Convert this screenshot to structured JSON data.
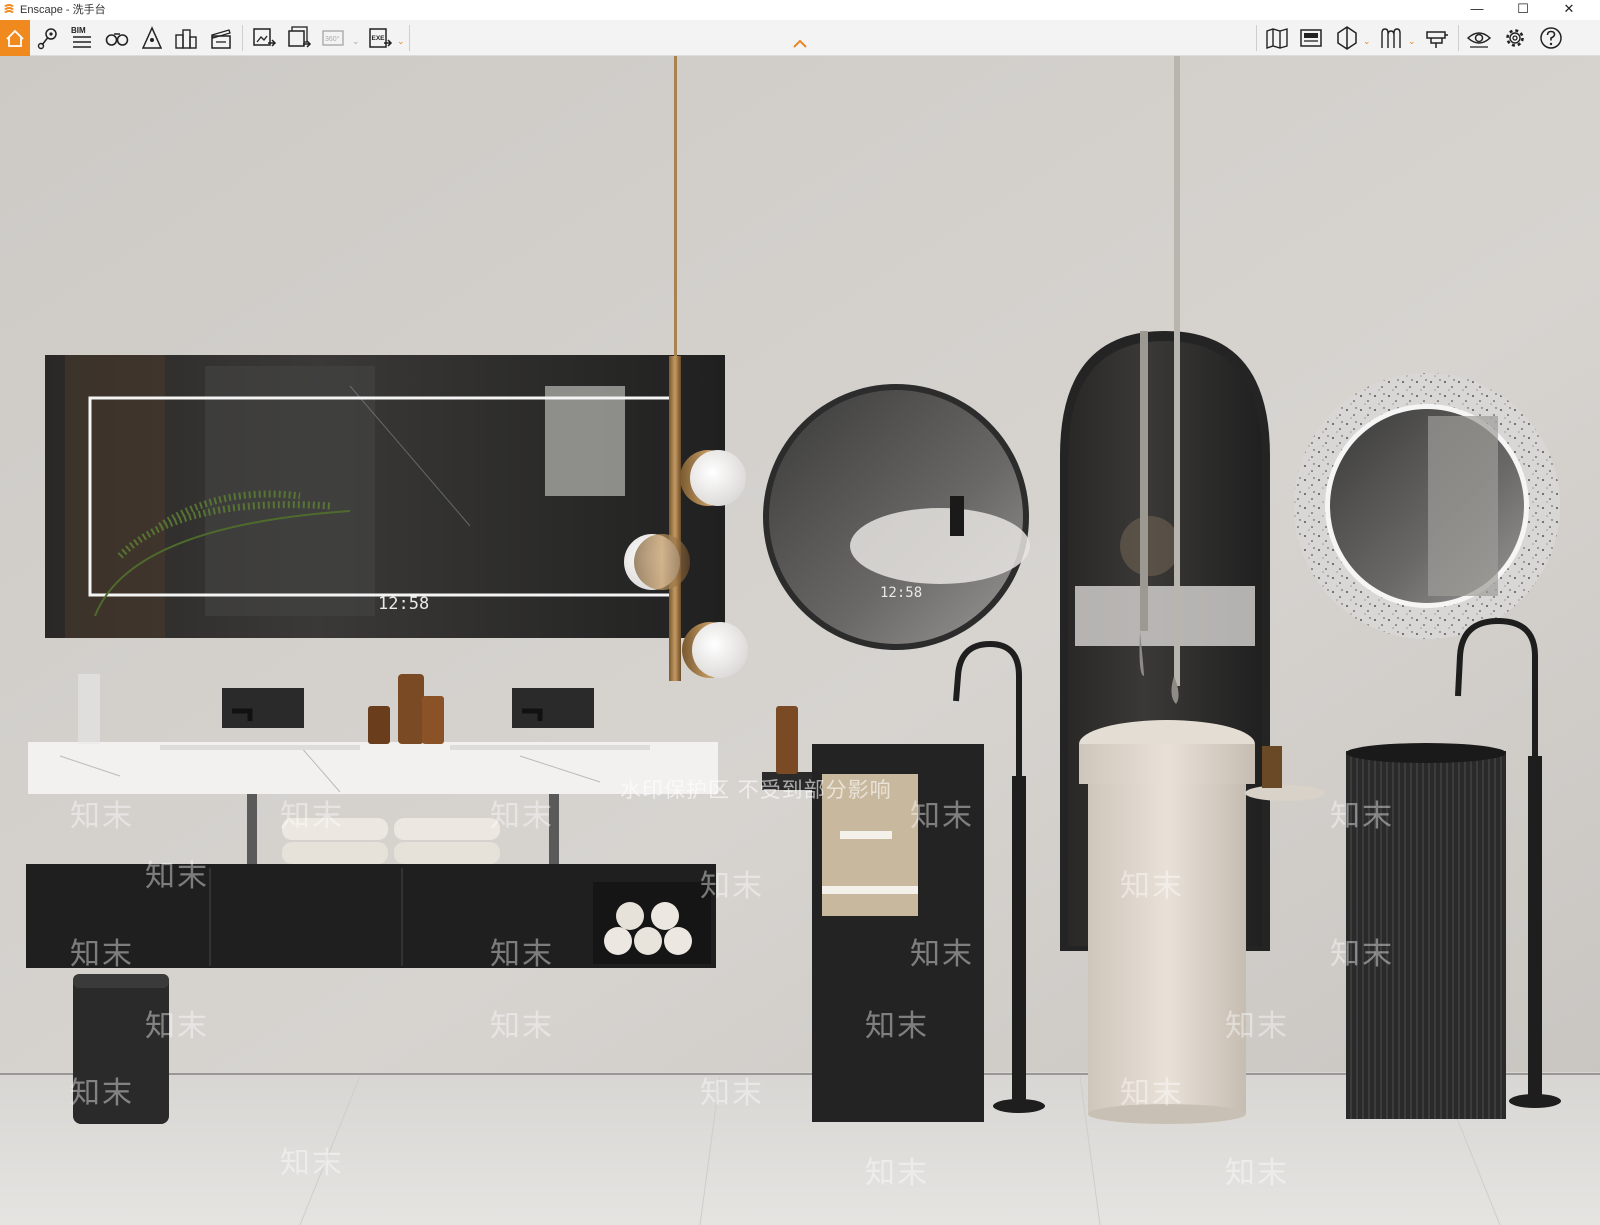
{
  "window": {
    "app_name": "Enscape",
    "title": "Enscape - 洗手台",
    "controls": {
      "minimize": "—",
      "maximize": "☐",
      "close": "✕"
    }
  },
  "toolbar": {
    "accent_color": "#f08a1e",
    "left_tools": [
      {
        "name": "home-icon"
      },
      {
        "name": "location-pin-icon"
      },
      {
        "name": "bim-icon",
        "label": "BIM"
      },
      {
        "name": "binoculars-icon"
      },
      {
        "name": "light-cone-icon"
      },
      {
        "name": "buildings-icon"
      },
      {
        "name": "clapperboard-icon"
      }
    ],
    "export_tools": [
      {
        "name": "export-image-icon"
      },
      {
        "name": "batch-render-icon"
      },
      {
        "name": "panorama-icon",
        "label": "360°",
        "disabled": true
      },
      {
        "name": "exe-export-icon",
        "label": "EXE"
      }
    ],
    "right_tools": [
      {
        "name": "map-icon"
      },
      {
        "name": "view-management-icon"
      },
      {
        "name": "section-icon"
      },
      {
        "name": "asset-library-icon"
      },
      {
        "name": "material-editor-icon"
      },
      {
        "name": "visual-settings-icon"
      },
      {
        "name": "settings-gear-icon"
      },
      {
        "name": "help-icon"
      }
    ]
  },
  "viewport": {
    "mirror_clock": "12:58",
    "round_mirror_clock": "12:58",
    "watermark_text": "知末",
    "watermark_notice": "水印保护区  不受到部分影响"
  }
}
